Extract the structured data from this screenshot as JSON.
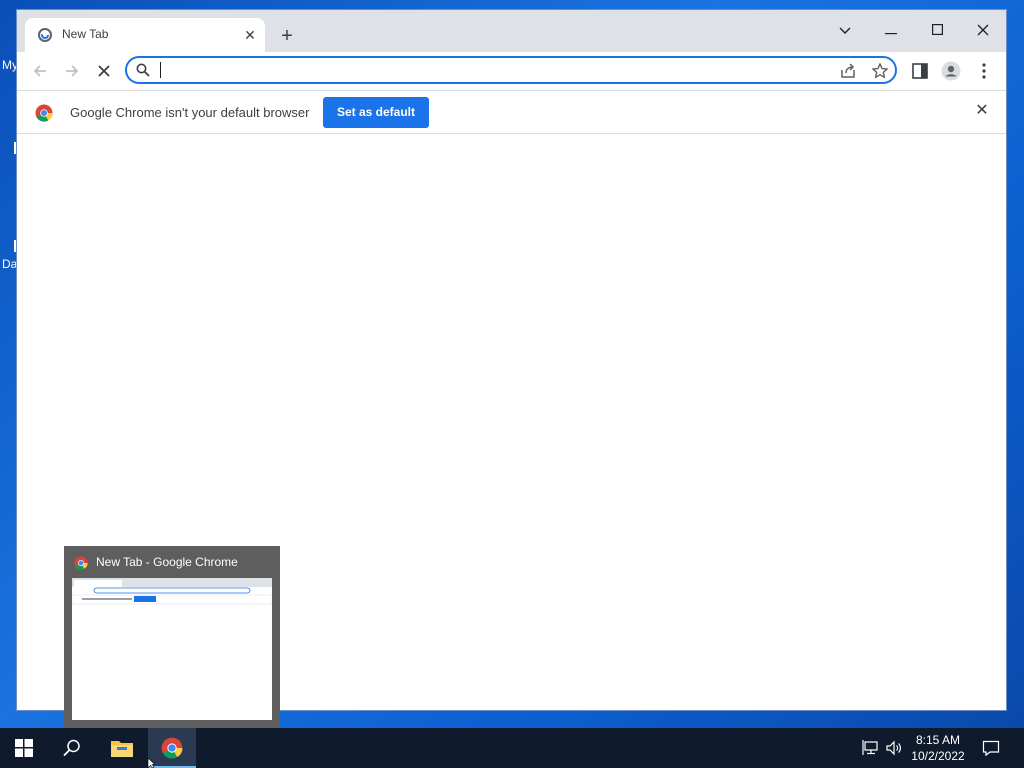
{
  "desktop": {
    "icon_labels": [
      "My",
      "Da"
    ]
  },
  "browser": {
    "tab": {
      "title": "New Tab"
    },
    "omnibox": {
      "value": "",
      "placeholder": ""
    },
    "infobar": {
      "message": "Google Chrome isn't your default browser",
      "button_label": "Set as default"
    }
  },
  "taskbar": {
    "preview_title": "New Tab - Google Chrome",
    "clock": {
      "time": "8:15 AM",
      "date": "10/2/2022"
    }
  },
  "colors": {
    "accent": "#1a73e8",
    "taskbar": "#0f1b2d",
    "desktop": "#1a73e0"
  }
}
